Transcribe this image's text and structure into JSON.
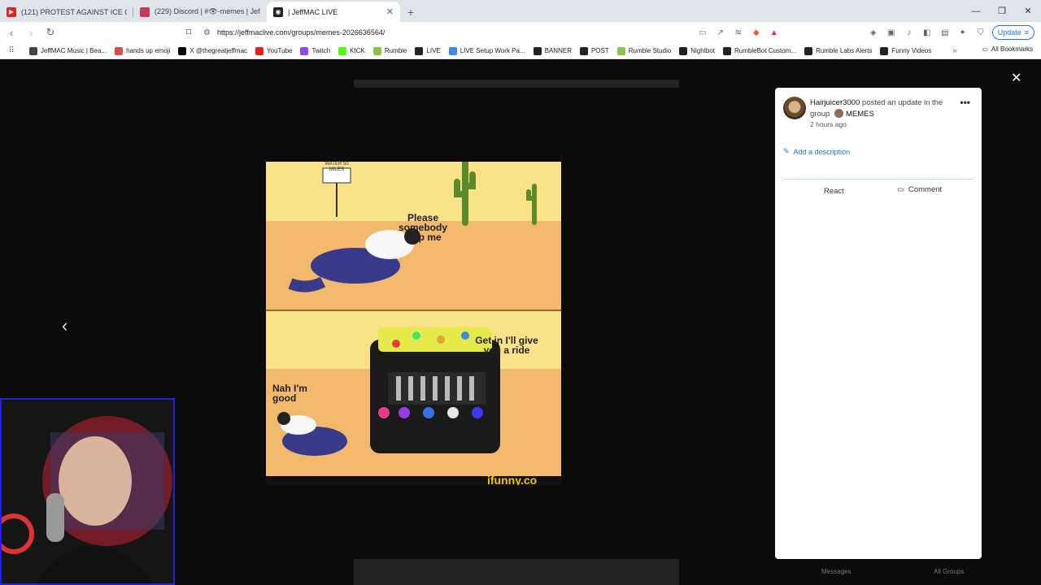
{
  "browser": {
    "tabs": [
      {
        "label": "(121) PROTEST AGAINST ICE CONTIN",
        "favicon_color": "#e62117",
        "active": false
      },
      {
        "label": "(229) Discord | #👁-memes | JeffMA",
        "favicon_color": "#c43a5a",
        "active": false
      },
      {
        "label": "| JeffMAC LIVE",
        "favicon_color": "#222222",
        "active": true
      }
    ],
    "url": "https://jeffmaclive.com/groups/memes-2026636564/",
    "update_label": "Update",
    "bookmarks": [
      {
        "label": "JeffMAC Music | Bea...",
        "color": "#444444"
      },
      {
        "label": "hands up emoji",
        "color": "#e04a4a"
      },
      {
        "label": "X @thegreatjeffmac",
        "color": "#000000"
      },
      {
        "label": "YouTube",
        "color": "#e62117"
      },
      {
        "label": "Twitch",
        "color": "#9146ff"
      },
      {
        "label": "KICK",
        "color": "#53fc18"
      },
      {
        "label": "Rumble",
        "color": "#85c742"
      },
      {
        "label": "LIVE",
        "color": "#222222"
      },
      {
        "label": "LIVE Setup Work Pa...",
        "color": "#4285f4"
      },
      {
        "label": "BANNER",
        "color": "#222222"
      },
      {
        "label": "POST",
        "color": "#222222"
      },
      {
        "label": "Rumble Studio",
        "color": "#85c742"
      },
      {
        "label": "Nightbot",
        "color": "#222222"
      },
      {
        "label": "RumbleBot Custom...",
        "color": "#222222"
      },
      {
        "label": "Rumble Labs Alerts",
        "color": "#222222"
      },
      {
        "label": "Funny Videos",
        "color": "#222222"
      }
    ],
    "all_bookmarks_label": "All Bookmarks"
  },
  "lightbox": {
    "meme": {
      "top_text": "Please somebody help me",
      "bottom_left_text": "Nah I'm good",
      "bottom_right_text": "Get in I'll give you a ride",
      "sign_text": "WATER 50 MILES",
      "watermark": "ifunny.co"
    }
  },
  "post": {
    "author": "Hairjuicer3000",
    "action": "posted an update in the group",
    "group": "MEMES",
    "time": "2 hours ago",
    "add_description": "Add a description",
    "react_label": "React",
    "comment_label": "Comment"
  },
  "background": {
    "bottom_left": "Messages",
    "bottom_right": "All Groups"
  }
}
